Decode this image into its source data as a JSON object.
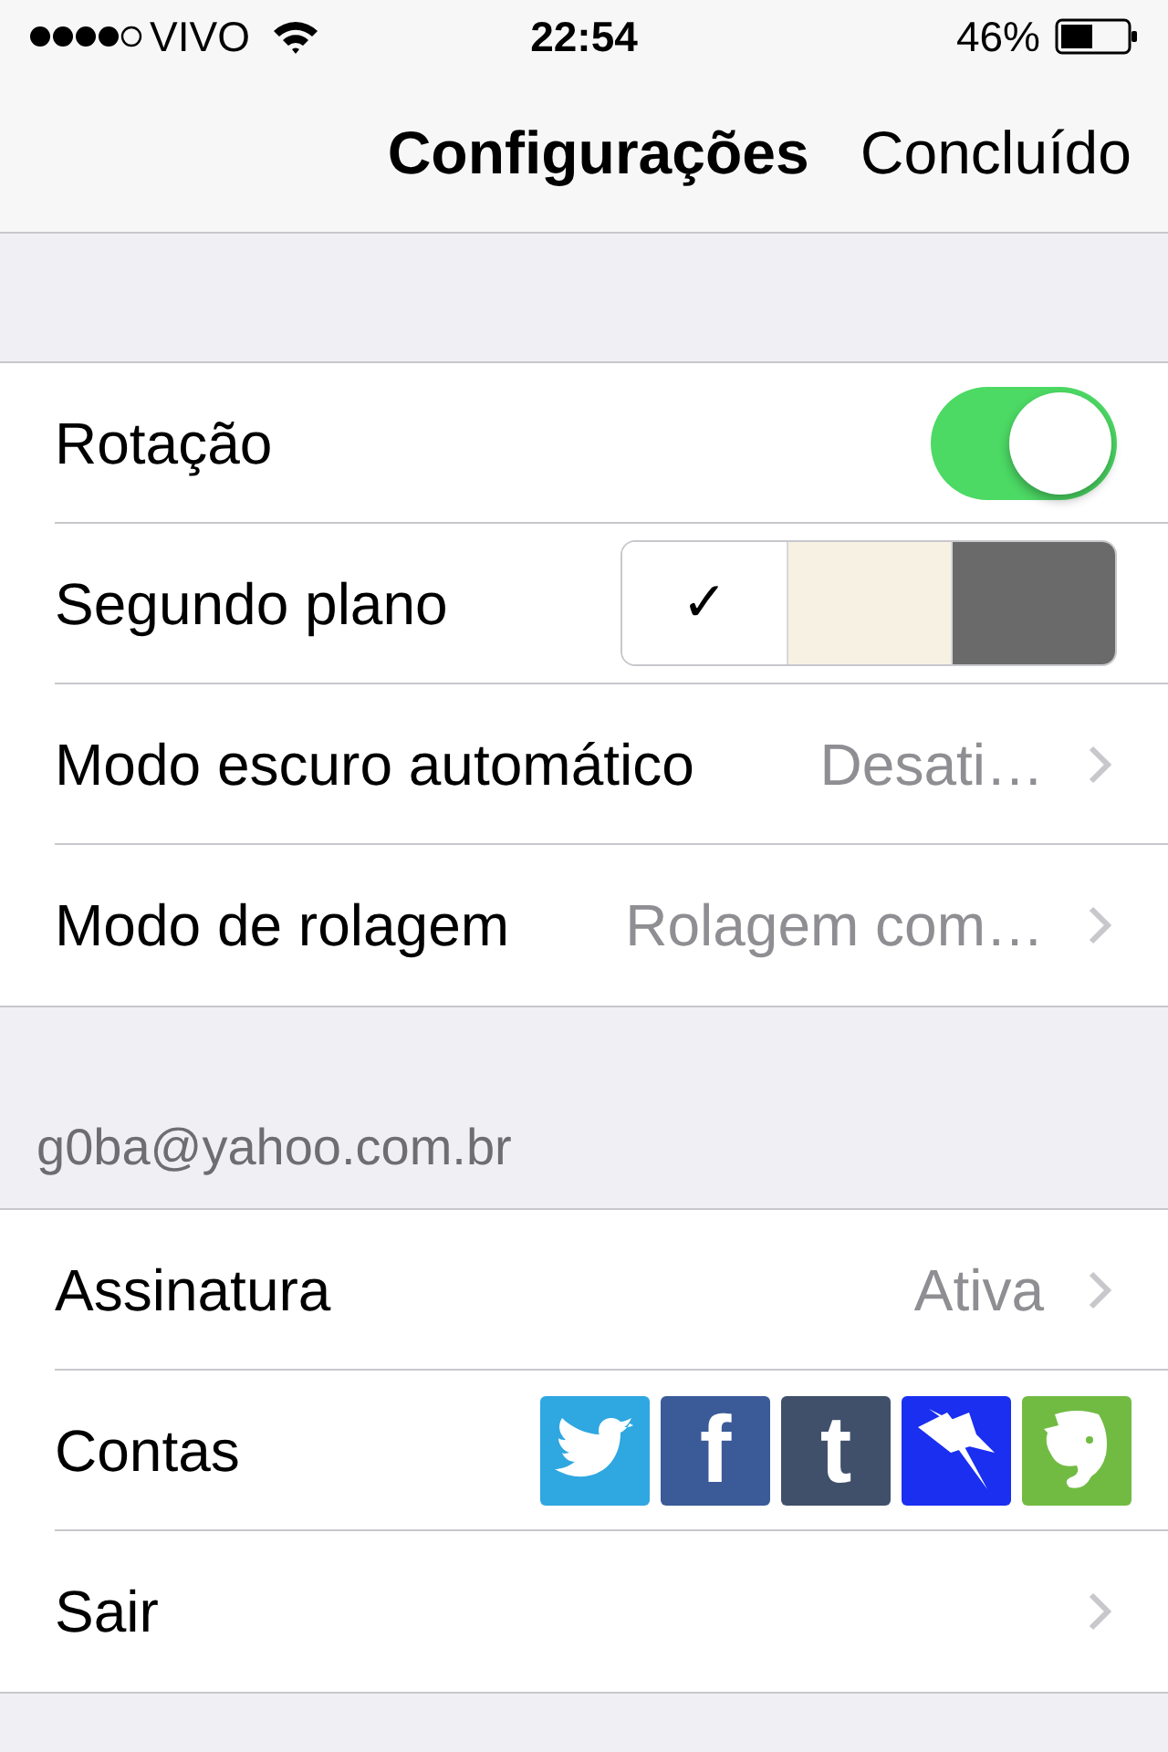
{
  "status_bar": {
    "carrier": "VIVO",
    "time": "22:54",
    "battery": "46%"
  },
  "nav_bar": {
    "title": "Configurações",
    "done": "Concluído"
  },
  "sections": [
    {
      "rows": [
        {
          "kind": "toggle",
          "label": "Rotação",
          "on": true
        },
        {
          "kind": "swatches",
          "label": "Segundo plano",
          "check_glyph": "✓",
          "swatches": [
            {
              "color": "#ffffff",
              "selected": true
            },
            {
              "color": "#f6f1e3",
              "selected": false
            },
            {
              "color": "#6a6a6a",
              "selected": false
            }
          ]
        },
        {
          "kind": "value",
          "label": "Modo escuro automático",
          "value": "Desati…",
          "chevron": true
        },
        {
          "kind": "value",
          "label": "Modo de rolagem",
          "value": "Rolagem com…",
          "chevron": true
        }
      ]
    },
    {
      "header": "g0ba@yahoo.com.br",
      "rows": [
        {
          "kind": "value",
          "label": "Assinatura",
          "value": "Ativa",
          "chevron": true
        },
        {
          "kind": "accounts",
          "label": "Contas",
          "services": [
            {
              "kind": "bird",
              "color": "#2fa7e0"
            },
            {
              "kind": "letter",
              "glyph": "f",
              "color": "#3a5a98"
            },
            {
              "kind": "letter",
              "glyph": "t",
              "color": "#40506a"
            },
            {
              "kind": "pin",
              "color": "#1a2ff0"
            },
            {
              "kind": "elephant",
              "color": "#72bb43"
            }
          ]
        },
        {
          "kind": "value",
          "label": "Sair",
          "chevron": true
        }
      ]
    }
  ]
}
